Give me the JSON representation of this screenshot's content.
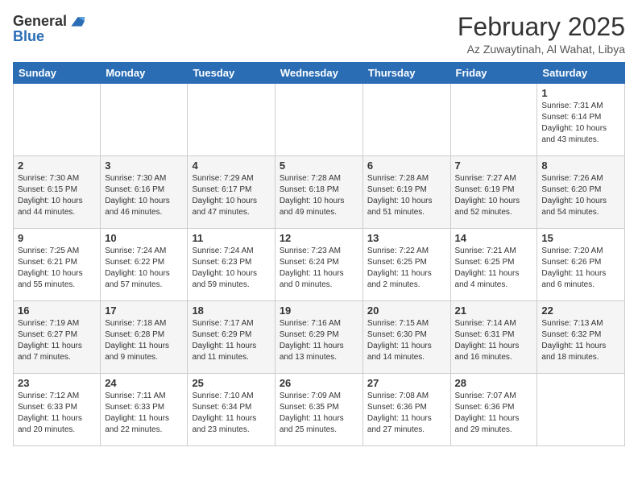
{
  "logo": {
    "general": "General",
    "blue": "Blue"
  },
  "title": {
    "month": "February 2025",
    "location": "Az Zuwaytinah, Al Wahat, Libya"
  },
  "weekdays": [
    "Sunday",
    "Monday",
    "Tuesday",
    "Wednesday",
    "Thursday",
    "Friday",
    "Saturday"
  ],
  "weeks": [
    [
      {
        "day": "",
        "text": ""
      },
      {
        "day": "",
        "text": ""
      },
      {
        "day": "",
        "text": ""
      },
      {
        "day": "",
        "text": ""
      },
      {
        "day": "",
        "text": ""
      },
      {
        "day": "",
        "text": ""
      },
      {
        "day": "1",
        "text": "Sunrise: 7:31 AM\nSunset: 6:14 PM\nDaylight: 10 hours\nand 43 minutes."
      }
    ],
    [
      {
        "day": "2",
        "text": "Sunrise: 7:30 AM\nSunset: 6:15 PM\nDaylight: 10 hours\nand 44 minutes."
      },
      {
        "day": "3",
        "text": "Sunrise: 7:30 AM\nSunset: 6:16 PM\nDaylight: 10 hours\nand 46 minutes."
      },
      {
        "day": "4",
        "text": "Sunrise: 7:29 AM\nSunset: 6:17 PM\nDaylight: 10 hours\nand 47 minutes."
      },
      {
        "day": "5",
        "text": "Sunrise: 7:28 AM\nSunset: 6:18 PM\nDaylight: 10 hours\nand 49 minutes."
      },
      {
        "day": "6",
        "text": "Sunrise: 7:28 AM\nSunset: 6:19 PM\nDaylight: 10 hours\nand 51 minutes."
      },
      {
        "day": "7",
        "text": "Sunrise: 7:27 AM\nSunset: 6:19 PM\nDaylight: 10 hours\nand 52 minutes."
      },
      {
        "day": "8",
        "text": "Sunrise: 7:26 AM\nSunset: 6:20 PM\nDaylight: 10 hours\nand 54 minutes."
      }
    ],
    [
      {
        "day": "9",
        "text": "Sunrise: 7:25 AM\nSunset: 6:21 PM\nDaylight: 10 hours\nand 55 minutes."
      },
      {
        "day": "10",
        "text": "Sunrise: 7:24 AM\nSunset: 6:22 PM\nDaylight: 10 hours\nand 57 minutes."
      },
      {
        "day": "11",
        "text": "Sunrise: 7:24 AM\nSunset: 6:23 PM\nDaylight: 10 hours\nand 59 minutes."
      },
      {
        "day": "12",
        "text": "Sunrise: 7:23 AM\nSunset: 6:24 PM\nDaylight: 11 hours\nand 0 minutes."
      },
      {
        "day": "13",
        "text": "Sunrise: 7:22 AM\nSunset: 6:25 PM\nDaylight: 11 hours\nand 2 minutes."
      },
      {
        "day": "14",
        "text": "Sunrise: 7:21 AM\nSunset: 6:25 PM\nDaylight: 11 hours\nand 4 minutes."
      },
      {
        "day": "15",
        "text": "Sunrise: 7:20 AM\nSunset: 6:26 PM\nDaylight: 11 hours\nand 6 minutes."
      }
    ],
    [
      {
        "day": "16",
        "text": "Sunrise: 7:19 AM\nSunset: 6:27 PM\nDaylight: 11 hours\nand 7 minutes."
      },
      {
        "day": "17",
        "text": "Sunrise: 7:18 AM\nSunset: 6:28 PM\nDaylight: 11 hours\nand 9 minutes."
      },
      {
        "day": "18",
        "text": "Sunrise: 7:17 AM\nSunset: 6:29 PM\nDaylight: 11 hours\nand 11 minutes."
      },
      {
        "day": "19",
        "text": "Sunrise: 7:16 AM\nSunset: 6:29 PM\nDaylight: 11 hours\nand 13 minutes."
      },
      {
        "day": "20",
        "text": "Sunrise: 7:15 AM\nSunset: 6:30 PM\nDaylight: 11 hours\nand 14 minutes."
      },
      {
        "day": "21",
        "text": "Sunrise: 7:14 AM\nSunset: 6:31 PM\nDaylight: 11 hours\nand 16 minutes."
      },
      {
        "day": "22",
        "text": "Sunrise: 7:13 AM\nSunset: 6:32 PM\nDaylight: 11 hours\nand 18 minutes."
      }
    ],
    [
      {
        "day": "23",
        "text": "Sunrise: 7:12 AM\nSunset: 6:33 PM\nDaylight: 11 hours\nand 20 minutes."
      },
      {
        "day": "24",
        "text": "Sunrise: 7:11 AM\nSunset: 6:33 PM\nDaylight: 11 hours\nand 22 minutes."
      },
      {
        "day": "25",
        "text": "Sunrise: 7:10 AM\nSunset: 6:34 PM\nDaylight: 11 hours\nand 23 minutes."
      },
      {
        "day": "26",
        "text": "Sunrise: 7:09 AM\nSunset: 6:35 PM\nDaylight: 11 hours\nand 25 minutes."
      },
      {
        "day": "27",
        "text": "Sunrise: 7:08 AM\nSunset: 6:36 PM\nDaylight: 11 hours\nand 27 minutes."
      },
      {
        "day": "28",
        "text": "Sunrise: 7:07 AM\nSunset: 6:36 PM\nDaylight: 11 hours\nand 29 minutes."
      },
      {
        "day": "",
        "text": ""
      }
    ]
  ]
}
